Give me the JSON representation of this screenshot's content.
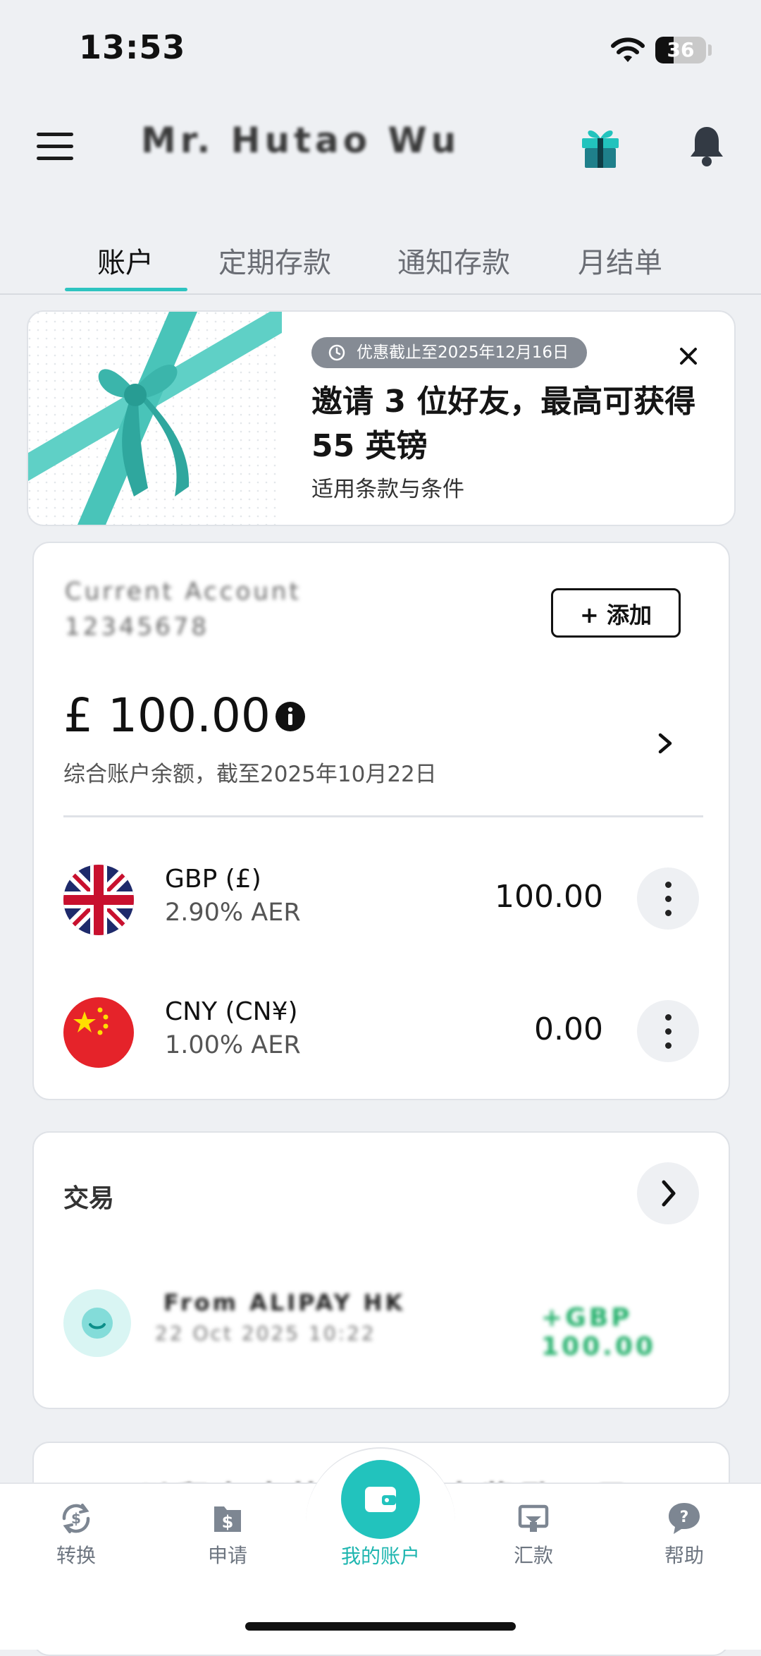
{
  "status_bar": {
    "time": "13:53",
    "battery": "36",
    "battery_level": 0.36
  },
  "header": {
    "username": "Mr. Hutao Wu"
  },
  "tabs": [
    "账户",
    "定期存款",
    "通知存款",
    "月结单"
  ],
  "promo": {
    "badge": "优惠截止至2025年12月16日",
    "title": "邀请 3 位好友，最高可获得 55 英镑",
    "terms": "适用条款与条件"
  },
  "account": {
    "name_line1": "Current Account",
    "name_line2": "12345678",
    "add_label": "+ 添加",
    "balance": "£ 100.00",
    "balance_note": "综合账户余额，截至2025年10月22日",
    "currencies": [
      {
        "code": "GBP (£)",
        "rate": "2.90% AER",
        "amount": "100.00"
      },
      {
        "code": "CNY (CN¥)",
        "rate": "1.00% AER",
        "amount": "0.00"
      }
    ]
  },
  "transactions": {
    "title": "交易",
    "item": {
      "name": "From ALIPAY HK",
      "date": "22 Oct 2025 10:22",
      "amount": "+GBP 100.00"
    }
  },
  "peek_card": {
    "text": "以积存点快速换取点奖励一子"
  },
  "nav": {
    "items": [
      "转换",
      "申请",
      "我的账户",
      "汇款",
      "帮助"
    ]
  },
  "colors": {
    "accent": "#22c3bd",
    "positive": "#23b06b"
  }
}
